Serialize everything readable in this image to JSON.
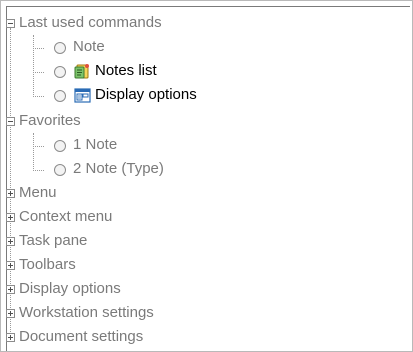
{
  "tree": {
    "groups": [
      {
        "label": "Last used commands",
        "expanded": true,
        "items": [
          {
            "label": "Note",
            "icon": "",
            "dark": false
          },
          {
            "label": "Notes list",
            "icon": "notes-list-icon",
            "dark": true
          },
          {
            "label": "Display options",
            "icon": "display-options-icon",
            "dark": true
          }
        ]
      },
      {
        "label": "Favorites",
        "expanded": true,
        "items": [
          {
            "label": "1 Note",
            "icon": "",
            "dark": false
          },
          {
            "label": "2 Note (Type)",
            "icon": "",
            "dark": false
          }
        ]
      },
      {
        "label": "Menu",
        "expanded": false
      },
      {
        "label": "Context menu",
        "expanded": false
      },
      {
        "label": "Task pane",
        "expanded": false
      },
      {
        "label": "Toolbars",
        "expanded": false
      },
      {
        "label": "Display options",
        "expanded": false
      },
      {
        "label": "Workstation settings",
        "expanded": false
      },
      {
        "label": "Document settings",
        "expanded": false
      }
    ]
  },
  "colors": {
    "text_gray": "#7a7a7a",
    "text_dark": "#000000",
    "border": "#b9b9b9"
  }
}
